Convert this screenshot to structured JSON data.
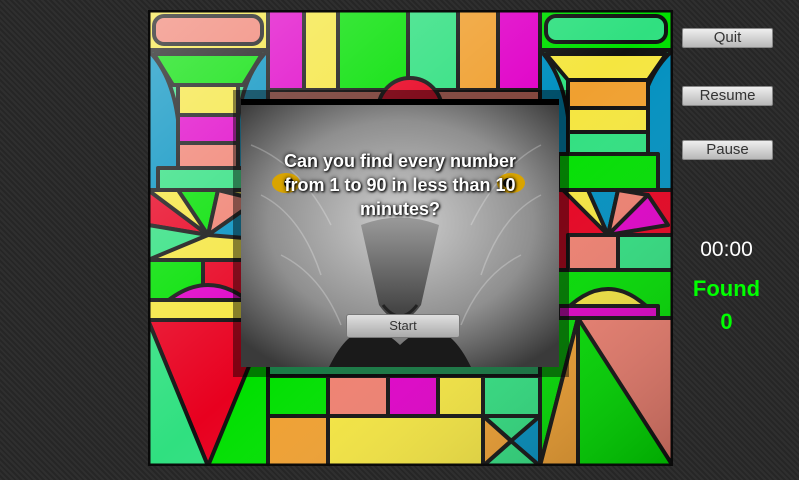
{
  "side_buttons": {
    "quit_label": "Quit",
    "resume_label": "Resume",
    "pause_label": "Pause"
  },
  "status": {
    "timer": "00:00",
    "found_label": "Found",
    "found_count": "0"
  },
  "dialog": {
    "message": "Can you find every number from 1 to 90 in less than 10 minutes?",
    "start_label": "Start"
  },
  "colors": {
    "red": "#e8001f",
    "green": "#00e000",
    "yellow": "#f5e640",
    "magenta": "#e000c8",
    "blue": "#0090c0",
    "salmon": "#f08070",
    "mint": "#30e080",
    "orange": "#f0a030",
    "found_text": "#00ff00"
  }
}
